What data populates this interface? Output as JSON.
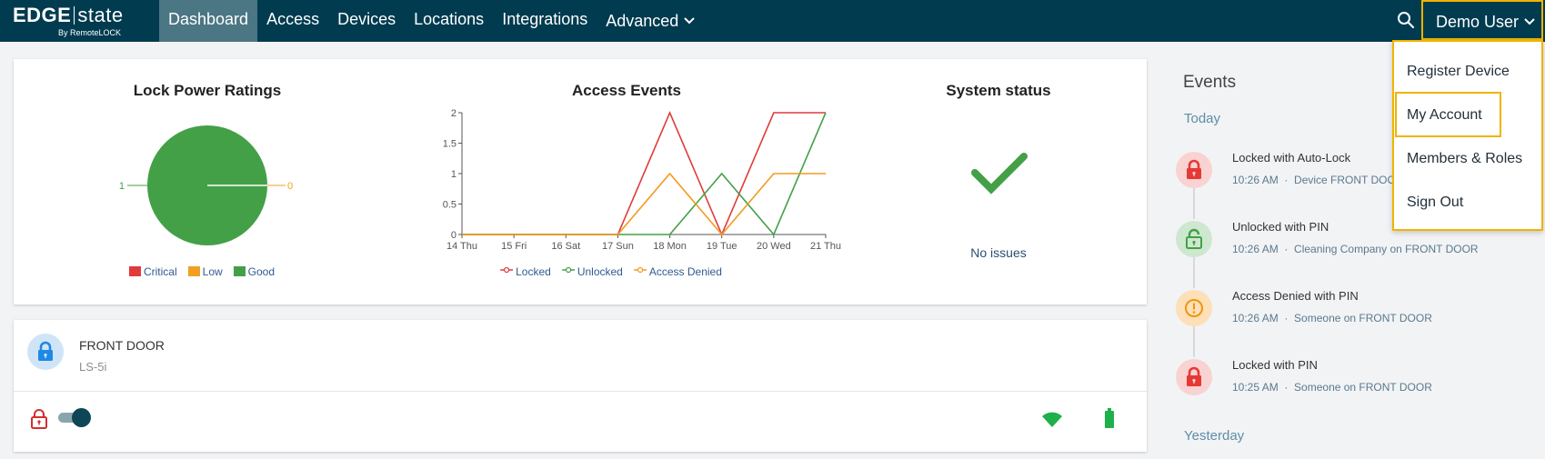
{
  "brand": {
    "name_bold": "EDGE",
    "name_light": "state",
    "byline": "By RemoteLOCK"
  },
  "nav": {
    "items": [
      {
        "label": "Dashboard",
        "active": true
      },
      {
        "label": "Access"
      },
      {
        "label": "Devices"
      },
      {
        "label": "Locations"
      },
      {
        "label": "Integrations"
      },
      {
        "label": "Advanced",
        "has_dropdown": true
      }
    ],
    "search_icon": "search-icon",
    "user_label": "Demo User"
  },
  "user_dropdown": {
    "items": [
      "Register Device",
      "My Account",
      "Members & Roles",
      "Sign Out"
    ],
    "highlighted": "My Account"
  },
  "lock_power": {
    "title": "Lock Power Ratings",
    "chart_data": {
      "type": "pie",
      "categories": [
        "Critical",
        "Low",
        "Good"
      ],
      "values": [
        0,
        0,
        1
      ],
      "colors": [
        "#e03b3b",
        "#f0a020",
        "#43a047"
      ],
      "annotations": [
        "1",
        "0"
      ],
      "legend_position": "bottom"
    },
    "legend": [
      "Critical",
      "Low",
      "Good"
    ]
  },
  "access_events": {
    "title": "Access Events",
    "chart_data": {
      "type": "line",
      "categories": [
        "14 Thu",
        "15 Fri",
        "16 Sat",
        "17 Sun",
        "18 Mon",
        "19 Tue",
        "20 Wed",
        "21 Thu"
      ],
      "y_ticks": [
        "0",
        "0.5",
        "1",
        "1.5",
        "2"
      ],
      "ylim": [
        0,
        2
      ],
      "series": [
        {
          "name": "Locked",
          "color": "#e03b3b",
          "values": [
            0,
            0,
            0,
            0,
            2,
            0,
            2,
            2
          ]
        },
        {
          "name": "Unlocked",
          "color": "#43a047",
          "values": [
            0,
            0,
            0,
            0,
            0,
            1,
            0,
            2
          ]
        },
        {
          "name": "Access Denied",
          "color": "#f39a1c",
          "values": [
            0,
            0,
            0,
            0,
            1,
            0,
            1,
            1
          ]
        }
      ],
      "legend_position": "bottom",
      "grid": false
    }
  },
  "system_status": {
    "title": "System status",
    "status_text": "No issues",
    "icon": "checkmark-icon",
    "color": "#43a047"
  },
  "device": {
    "name": "FRONT DOOR",
    "model": "LS-5i",
    "icon": "lock-icon",
    "lock_state_icon": "unlocked-icon",
    "wifi_icon": "wifi-icon",
    "battery_icon": "battery-icon"
  },
  "events": {
    "title": "Events",
    "today_label": "Today",
    "yesterday_label": "Yesterday",
    "items": [
      {
        "title": "Locked with Auto-Lock",
        "time": "10:26 AM",
        "detail": "Device FRONT DOOR",
        "type": "locked",
        "icon": "lock-icon"
      },
      {
        "title": "Unlocked with PIN",
        "time": "10:26 AM",
        "detail": "Cleaning Company on FRONT DOOR",
        "type": "unlocked",
        "icon": "unlock-icon"
      },
      {
        "title": "Access Denied with PIN",
        "time": "10:26 AM",
        "detail": "Someone on FRONT DOOR",
        "type": "denied",
        "icon": "warning-icon"
      },
      {
        "title": "Locked with PIN",
        "time": "10:25 AM",
        "detail": "Someone on FRONT DOOR",
        "type": "locked",
        "icon": "lock-icon"
      }
    ]
  }
}
